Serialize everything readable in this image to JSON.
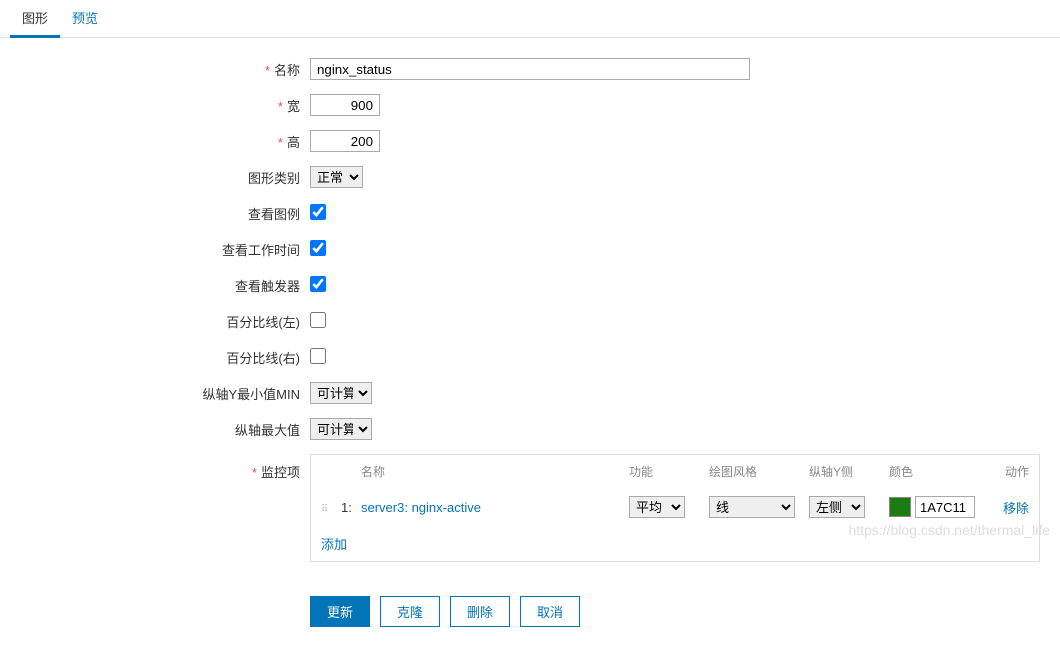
{
  "tabs": {
    "graph": "图形",
    "preview": "预览"
  },
  "labels": {
    "name": "名称",
    "width": "宽",
    "height": "高",
    "graphType": "图形类别",
    "showLegend": "查看图例",
    "showWorkPeriod": "查看工作时间",
    "showTriggers": "查看触发器",
    "percentLeft": "百分比线(左)",
    "percentRight": "百分比线(右)",
    "yAxisMin": "纵轴Y最小值MIN",
    "yAxisMax": "纵轴最大值",
    "monitorItems": "监控项"
  },
  "values": {
    "name": "nginx_status",
    "width": "900",
    "height": "200",
    "graphType": "正常",
    "yAxisMin": "可计算的",
    "yAxisMax": "可计算的"
  },
  "checks": {
    "showLegend": true,
    "showWorkPeriod": true,
    "showTriggers": true,
    "percentLeft": false,
    "percentRight": false
  },
  "itemsHeader": {
    "name": "名称",
    "func": "功能",
    "style": "绘图风格",
    "axis": "纵轴Y侧",
    "color": "颜色",
    "action": "动作"
  },
  "items": [
    {
      "idx": "1:",
      "name": "server3: nginx-active",
      "func": "平均",
      "style": "线",
      "axis": "左侧",
      "color": "1A7C11",
      "remove": "移除"
    }
  ],
  "addLabel": "添加",
  "buttons": {
    "update": "更新",
    "clone": "克隆",
    "delete": "删除",
    "cancel": "取消"
  },
  "watermark": "https://blog.csdn.net/thermal_life"
}
